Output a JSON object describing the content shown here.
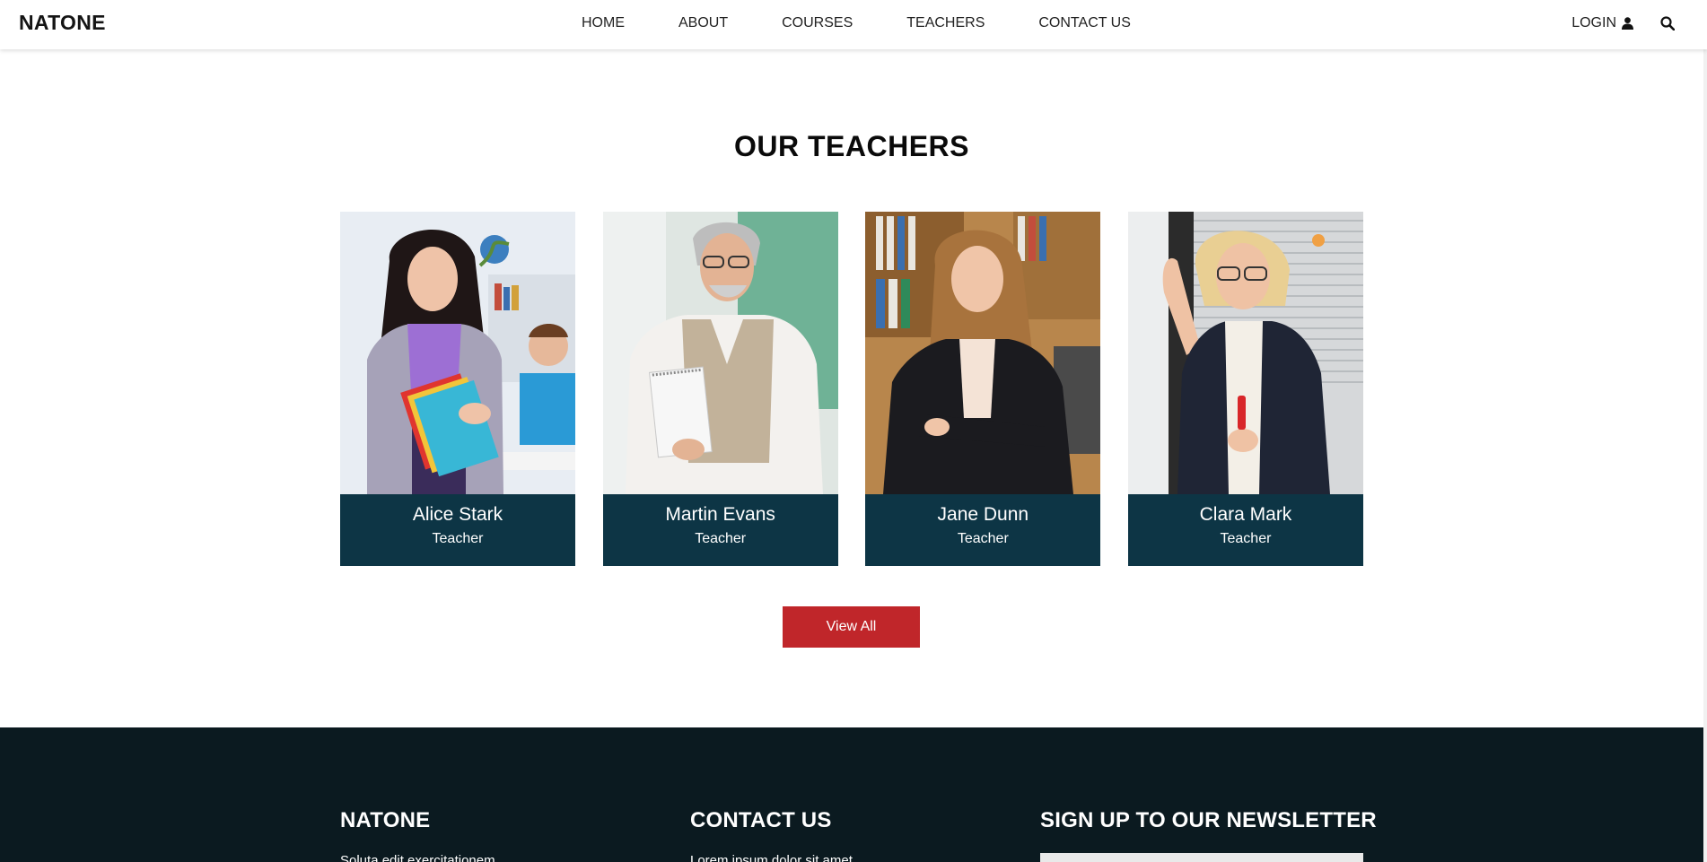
{
  "header": {
    "brand": "NATONE",
    "nav": [
      "HOME",
      "ABOUT",
      "COURSES",
      "TEACHERS",
      "CONTACT US"
    ],
    "login_label": "LOGIN",
    "icons": [
      "user-icon",
      "search-icon"
    ]
  },
  "teachers_section": {
    "title": "OUR TEACHERS",
    "teachers": [
      {
        "name": "Alice Stark",
        "role": "Teacher"
      },
      {
        "name": "Martin Evans",
        "role": "Teacher"
      },
      {
        "name": "Jane Dunn",
        "role": "Teacher"
      },
      {
        "name": "Clara Mark",
        "role": "Teacher"
      }
    ],
    "view_all_label": "View All"
  },
  "footer": {
    "col1": {
      "heading": "NATONE",
      "text": "Soluta edit exercitationem"
    },
    "col2": {
      "heading": "CONTACT US",
      "text": "Lorem ipsum dolor sit amet"
    },
    "col3": {
      "heading": "SIGN UP TO OUR NEWSLETTER"
    }
  },
  "colors": {
    "caption_bg": "#0d3545",
    "button_bg": "#c0262a",
    "footer_bg": "#0b1a20"
  }
}
